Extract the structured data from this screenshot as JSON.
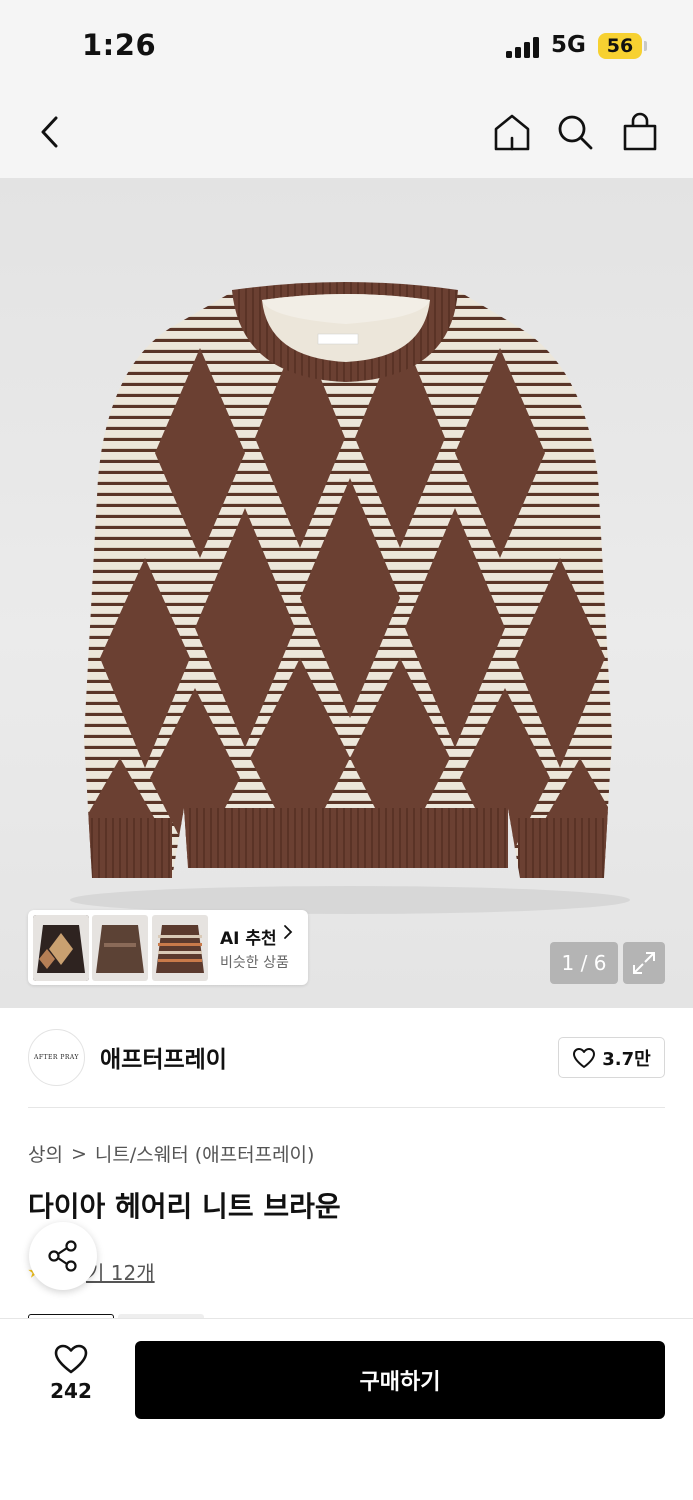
{
  "status": {
    "time": "1:26",
    "network": "5G",
    "battery": "56"
  },
  "nav": {
    "back": "back-icon",
    "home": "home-icon",
    "search": "search-icon",
    "bag": "shopping-bag-icon"
  },
  "gallery": {
    "counter": "1 / 6",
    "ai": {
      "title": "AI 추천",
      "subtitle": "비슷한 상품"
    }
  },
  "brand": {
    "name": "애프터프레이",
    "logo_text": "AFTER PRAY",
    "likes": "3.7만"
  },
  "breadcrumb": {
    "category": "상의",
    "separator": ">",
    "subcategory": "니트/스웨터 (애프터프레이)"
  },
  "product": {
    "title": "다이아 헤어리 니트 브라운",
    "review_text": "후기 12개",
    "review_visible": "기 12개"
  },
  "bottom": {
    "wish_count": "242",
    "buy_label": "구매하기"
  },
  "colors": {
    "brown": "#6b4032",
    "cream": "#ece6da",
    "black": "#000000",
    "battery": "#f7d131"
  }
}
